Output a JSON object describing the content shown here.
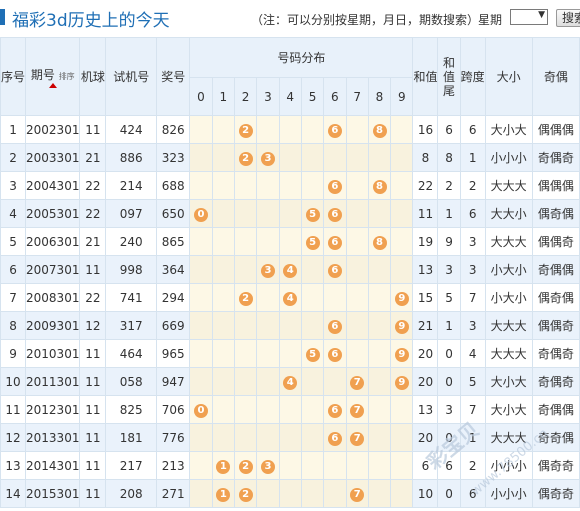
{
  "header": {
    "title": "福彩3d历史上的今天",
    "note": "（注：可以分别按星期，月日，期数搜索）",
    "week_label": "星期",
    "week_value": "",
    "search_label": "搜索"
  },
  "columns": {
    "seq": "序号",
    "period": "期号",
    "sort": "排序",
    "machine": "机球",
    "trial": "试机号",
    "prize": "奖号",
    "dist": "号码分布",
    "digits": [
      "0",
      "1",
      "2",
      "3",
      "4",
      "5",
      "6",
      "7",
      "8",
      "9"
    ],
    "sum": "和值",
    "tail": "和值尾",
    "span": "跨度",
    "size": "大小",
    "parity": "奇偶"
  },
  "rows": [
    {
      "seq": "1",
      "period": "2002301",
      "machine": "11",
      "trial": "424",
      "prize": "826",
      "balls": [
        2,
        6,
        8
      ],
      "sum": "16",
      "tail": "6",
      "span": "6",
      "size": "大小大",
      "parity": "偶偶偶"
    },
    {
      "seq": "2",
      "period": "2003301",
      "machine": "21",
      "trial": "886",
      "prize": "323",
      "balls": [
        2,
        3
      ],
      "sum": "8",
      "tail": "8",
      "span": "1",
      "size": "小小小",
      "parity": "奇偶奇"
    },
    {
      "seq": "3",
      "period": "2004301",
      "machine": "22",
      "trial": "214",
      "prize": "688",
      "balls": [
        6,
        8
      ],
      "sum": "22",
      "tail": "2",
      "span": "2",
      "size": "大大大",
      "parity": "偶偶偶"
    },
    {
      "seq": "4",
      "period": "2005301",
      "machine": "22",
      "trial": "097",
      "prize": "650",
      "balls": [
        0,
        5,
        6
      ],
      "sum": "11",
      "tail": "1",
      "span": "6",
      "size": "大大小",
      "parity": "偶奇偶"
    },
    {
      "seq": "5",
      "period": "2006301",
      "machine": "21",
      "trial": "240",
      "prize": "865",
      "balls": [
        5,
        6,
        8
      ],
      "sum": "19",
      "tail": "9",
      "span": "3",
      "size": "大大大",
      "parity": "偶偶奇"
    },
    {
      "seq": "6",
      "period": "2007301",
      "machine": "11",
      "trial": "998",
      "prize": "364",
      "balls": [
        3,
        4,
        6
      ],
      "sum": "13",
      "tail": "3",
      "span": "3",
      "size": "小大小",
      "parity": "奇偶偶"
    },
    {
      "seq": "7",
      "period": "2008301",
      "machine": "22",
      "trial": "741",
      "prize": "294",
      "balls": [
        2,
        4,
        9
      ],
      "sum": "15",
      "tail": "5",
      "span": "7",
      "size": "小大小",
      "parity": "偶奇偶"
    },
    {
      "seq": "8",
      "period": "2009301",
      "machine": "12",
      "trial": "317",
      "prize": "669",
      "balls": [
        6,
        9
      ],
      "sum": "21",
      "tail": "1",
      "span": "3",
      "size": "大大大",
      "parity": "偶偶奇"
    },
    {
      "seq": "9",
      "period": "2010301",
      "machine": "11",
      "trial": "464",
      "prize": "965",
      "balls": [
        5,
        6,
        9
      ],
      "sum": "20",
      "tail": "0",
      "span": "4",
      "size": "大大大",
      "parity": "奇偶奇"
    },
    {
      "seq": "10",
      "period": "2011301",
      "machine": "11",
      "trial": "058",
      "prize": "947",
      "balls": [
        4,
        7,
        9
      ],
      "sum": "20",
      "tail": "0",
      "span": "5",
      "size": "大小大",
      "parity": "奇偶奇"
    },
    {
      "seq": "11",
      "period": "2012301",
      "machine": "11",
      "trial": "825",
      "prize": "706",
      "balls": [
        0,
        6,
        7
      ],
      "sum": "13",
      "tail": "3",
      "span": "7",
      "size": "大小大",
      "parity": "奇偶偶"
    },
    {
      "seq": "12",
      "period": "2013301",
      "machine": "11",
      "trial": "181",
      "prize": "776",
      "balls": [
        6,
        7
      ],
      "sum": "20",
      "tail": "0",
      "span": "1",
      "size": "大大大",
      "parity": "奇奇偶"
    },
    {
      "seq": "13",
      "period": "2014301",
      "machine": "11",
      "trial": "217",
      "prize": "213",
      "balls": [
        1,
        2,
        3
      ],
      "sum": "6",
      "tail": "6",
      "span": "2",
      "size": "小小小",
      "parity": "偶奇奇"
    },
    {
      "seq": "14",
      "period": "2015301",
      "machine": "11",
      "trial": "208",
      "prize": "271",
      "balls": [
        1,
        2,
        7
      ],
      "sum": "10",
      "tail": "0",
      "span": "6",
      "size": "小小小",
      "parity": "偶奇奇"
    }
  ],
  "watermark": {
    "text": "彩宝贝",
    "url": "www.78500.cn"
  },
  "colors": {
    "accent": "#1f6fb5",
    "ball": "#f0a050",
    "row_alt": "#eaf2fb",
    "dist_bg": "#fdf8e6"
  }
}
